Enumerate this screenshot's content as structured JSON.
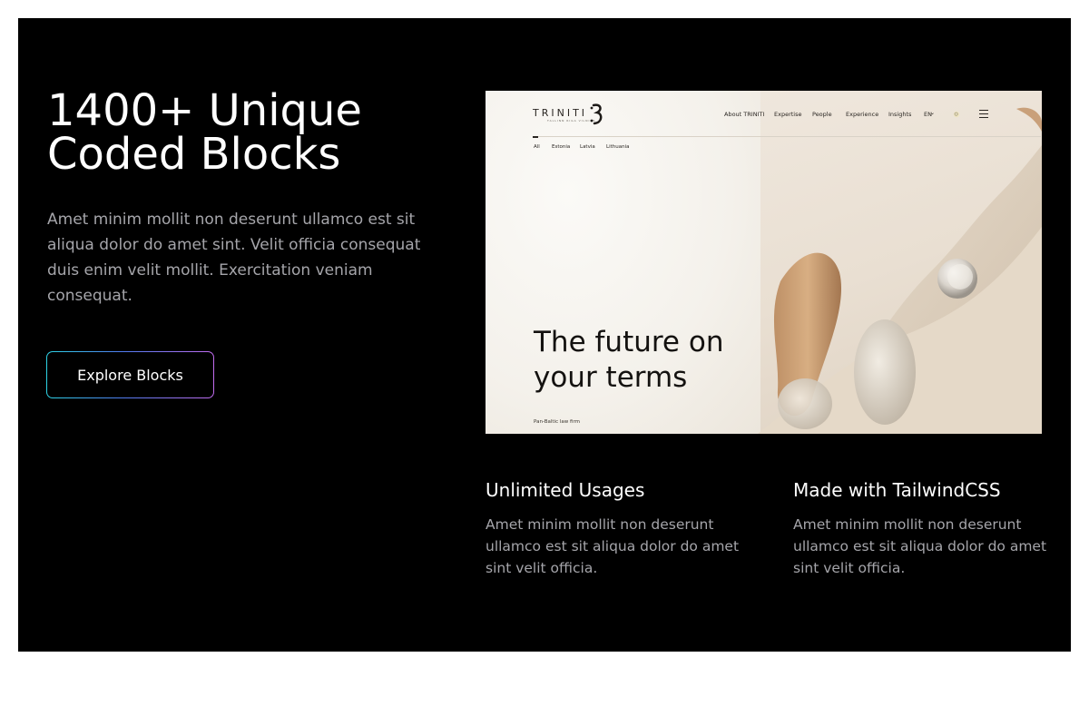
{
  "hero": {
    "headline": "1400+ Unique Coded Blocks",
    "lede": "Amet minim mollit non deserunt ullamco est sit aliqua dolor do amet sint. Velit officia consequat duis enim velit mollit. Exercitation veniam consequat.",
    "cta_label": "Explore Blocks"
  },
  "preview": {
    "logo": "TRINITI",
    "logo_sub": "TALLINN RIGA VILNIUS",
    "nav": [
      "About TRINITI",
      "Expertise",
      "People",
      "Experience",
      "Insights",
      "EN"
    ],
    "tabs": [
      "All",
      "Estonia",
      "Latvia",
      "Lithuania"
    ],
    "headline": "The future on your terms",
    "footer": "Pan-Baltic law firm"
  },
  "features": [
    {
      "title": "Unlimited Usages",
      "text": "Amet minim mollit non deserunt ullamco est sit aliqua dolor do amet sint velit officia."
    },
    {
      "title": "Made with TailwindCSS",
      "text": "Amet minim mollit non deserunt ullamco est sit aliqua dolor do amet sint velit officia."
    }
  ],
  "colors": {
    "background": "#000000",
    "page": "#ffffff",
    "text_primary": "#ffffff",
    "text_muted": "#a5a5aa",
    "cta_gradient": [
      "#2dd4e6",
      "#4f7cf0",
      "#c26cf0"
    ]
  },
  "icons": {
    "search": "search-icon",
    "menu": "hamburger-menu-icon",
    "language_caret": "chevron-down-icon"
  }
}
